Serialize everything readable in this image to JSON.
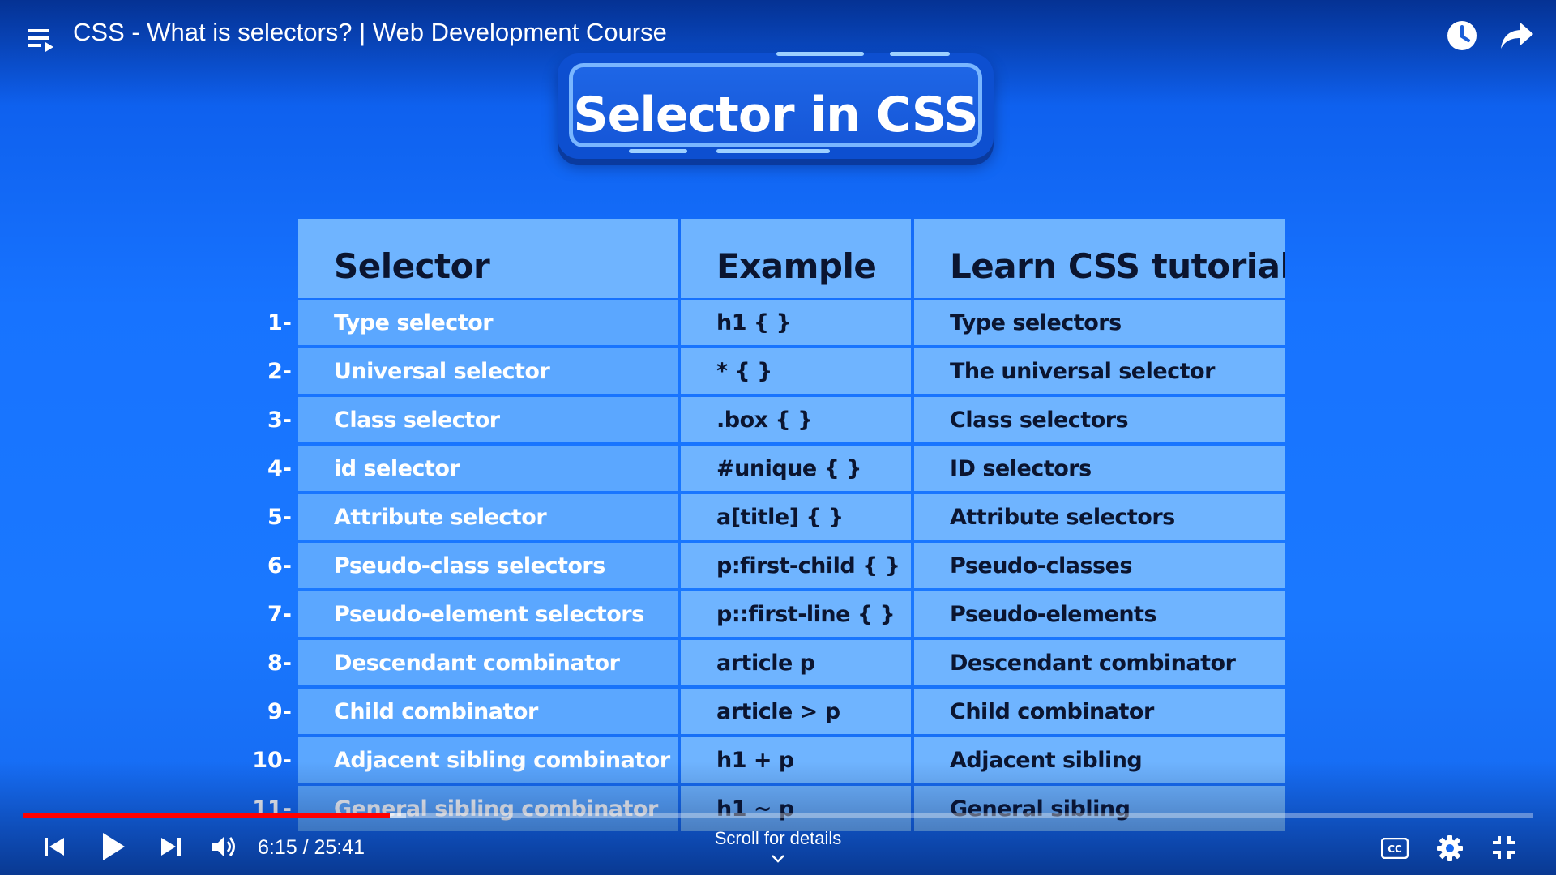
{
  "player": {
    "title": "CSS - What is selectors? | Web Development Course",
    "current_time": "6:15",
    "duration": "25:41",
    "time_text": "6:15 / 25:41",
    "progress_fraction": 0.243,
    "buffered_fraction": 0.254,
    "scroll_label": "Scroll for details",
    "colors": {
      "progress": "#ff0000",
      "background": "#1773ff"
    },
    "icons": {
      "playlist": "playlist-icon",
      "watch_later": "clock-icon",
      "share": "share-arrow-icon",
      "previous": "skip-previous-icon",
      "play": "play-icon",
      "next": "skip-next-icon",
      "volume": "volume-icon",
      "captions": "cc-icon",
      "settings": "gear-icon",
      "exit_fullscreen": "exit-fullscreen-icon"
    }
  },
  "slide": {
    "heading": "Selector in CSS",
    "table": {
      "headers": [
        "Selector",
        "Example",
        "Learn CSS tutorial"
      ],
      "rows": [
        {
          "num": "1-",
          "selector": "Type selector",
          "example": "h1 { }",
          "tutorial": "Type selectors"
        },
        {
          "num": "2-",
          "selector": "Universal selector",
          "example": "* { }",
          "tutorial": "The universal selector"
        },
        {
          "num": "3-",
          "selector": "Class selector",
          "example": ".box { }",
          "tutorial": "Class selectors"
        },
        {
          "num": "4-",
          "selector": "id selector",
          "example": "#unique { }",
          "tutorial": "ID selectors"
        },
        {
          "num": "5-",
          "selector": "Attribute selector",
          "example": "a[title] { }",
          "tutorial": "Attribute selectors"
        },
        {
          "num": "6-",
          "selector": "Pseudo-class selectors",
          "example": "p:first-child { }",
          "tutorial": "Pseudo-classes"
        },
        {
          "num": "7-",
          "selector": "Pseudo-element selectors",
          "example": "p::first-line { }",
          "tutorial": "Pseudo-elements"
        },
        {
          "num": "8-",
          "selector": "Descendant combinator",
          "example": "article p",
          "tutorial": "Descendant combinator"
        },
        {
          "num": "9-",
          "selector": "Child combinator",
          "example": "article > p",
          "tutorial": "Child combinator"
        },
        {
          "num": "10-",
          "selector": "Adjacent sibling combinator",
          "example": "h1 + p",
          "tutorial": "Adjacent sibling"
        },
        {
          "num": "11-",
          "selector": "General sibling combinator",
          "example": "h1 ~ p",
          "tutorial": "General sibling"
        }
      ]
    }
  }
}
